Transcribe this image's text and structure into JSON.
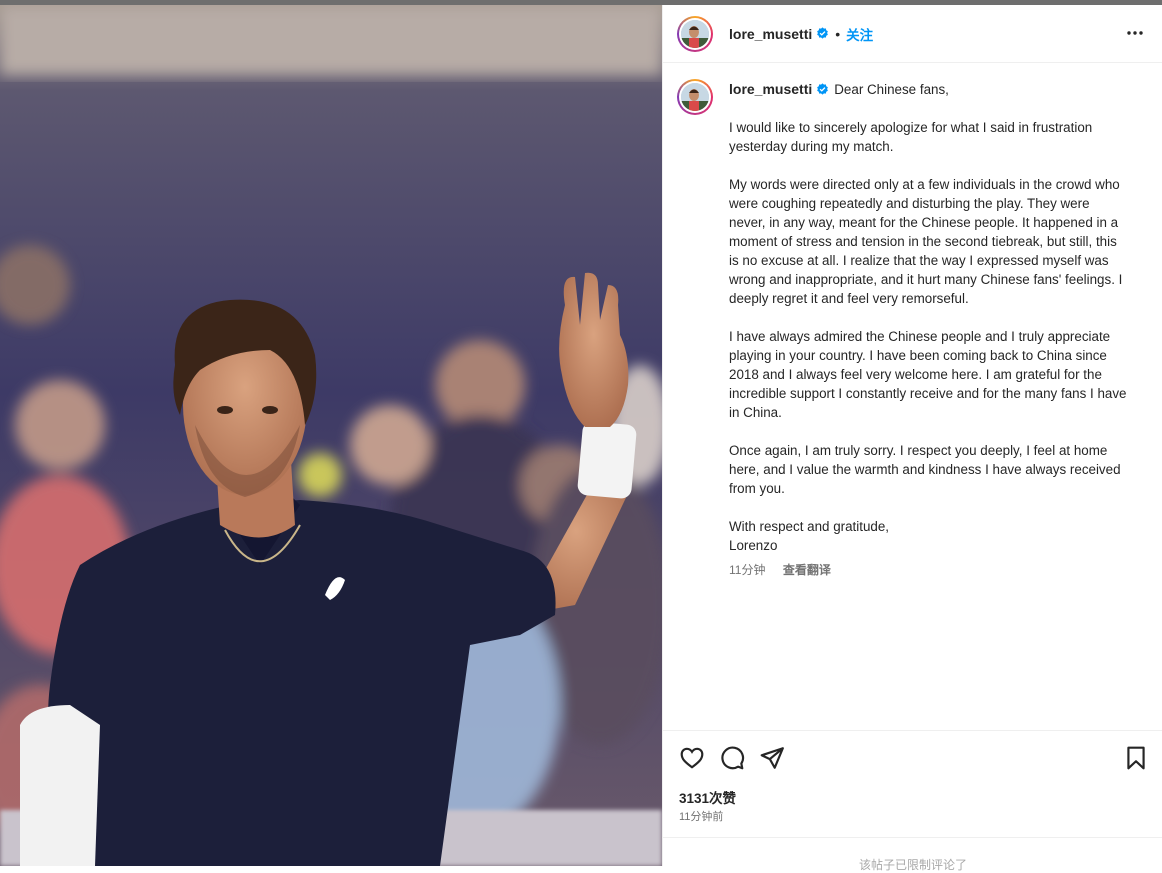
{
  "post": {
    "username": "lore_musetti",
    "follow_label": "关注",
    "dot": "•",
    "verified_icon": "verified-badge-icon",
    "more_icon": "more-options-icon"
  },
  "caption": {
    "greeting": "Dear Chinese fans,",
    "paragraphs": [
      "I would like to sincerely apologize for what I said in frustration yesterday during my match.",
      "My words were directed only at a few individuals in the crowd who were coughing repeatedly and disturbing the play. They were never, in any way, meant for the Chinese people. It happened in a moment of stress and tension in the second tiebreak, but still, this is no excuse at all. I realize that the way I expressed myself was wrong and inappropriate, and it hurt many Chinese fans' feelings. I deeply regret it and feel very remorseful.",
      "I have always admired the Chinese people and I truly appreciate playing in your country. I have been coming back to China since 2018 and I always feel very welcome here. I am grateful for the incredible support I constantly receive and for the many fans I have in China.",
      "Once again, I am truly sorry. I respect you deeply, I feel at home here, and I value the warmth and kindness I have always received from you."
    ],
    "closing": "With respect and gratitude,",
    "signature": "Lorenzo",
    "age": "11分钟",
    "translate_label": "查看翻译"
  },
  "actions": {
    "like_icon": "heart-icon",
    "comment_icon": "comment-icon",
    "share_icon": "share-icon",
    "save_icon": "bookmark-icon"
  },
  "stats": {
    "likes": "3131次赞",
    "posted_ago": "11分钟前"
  },
  "footer": {
    "comments_notice": "该帖子已限制评论了"
  },
  "colors": {
    "accent": "#0095f6",
    "verified": "#0095f6",
    "text": "#262626",
    "secondary": "#737373"
  }
}
